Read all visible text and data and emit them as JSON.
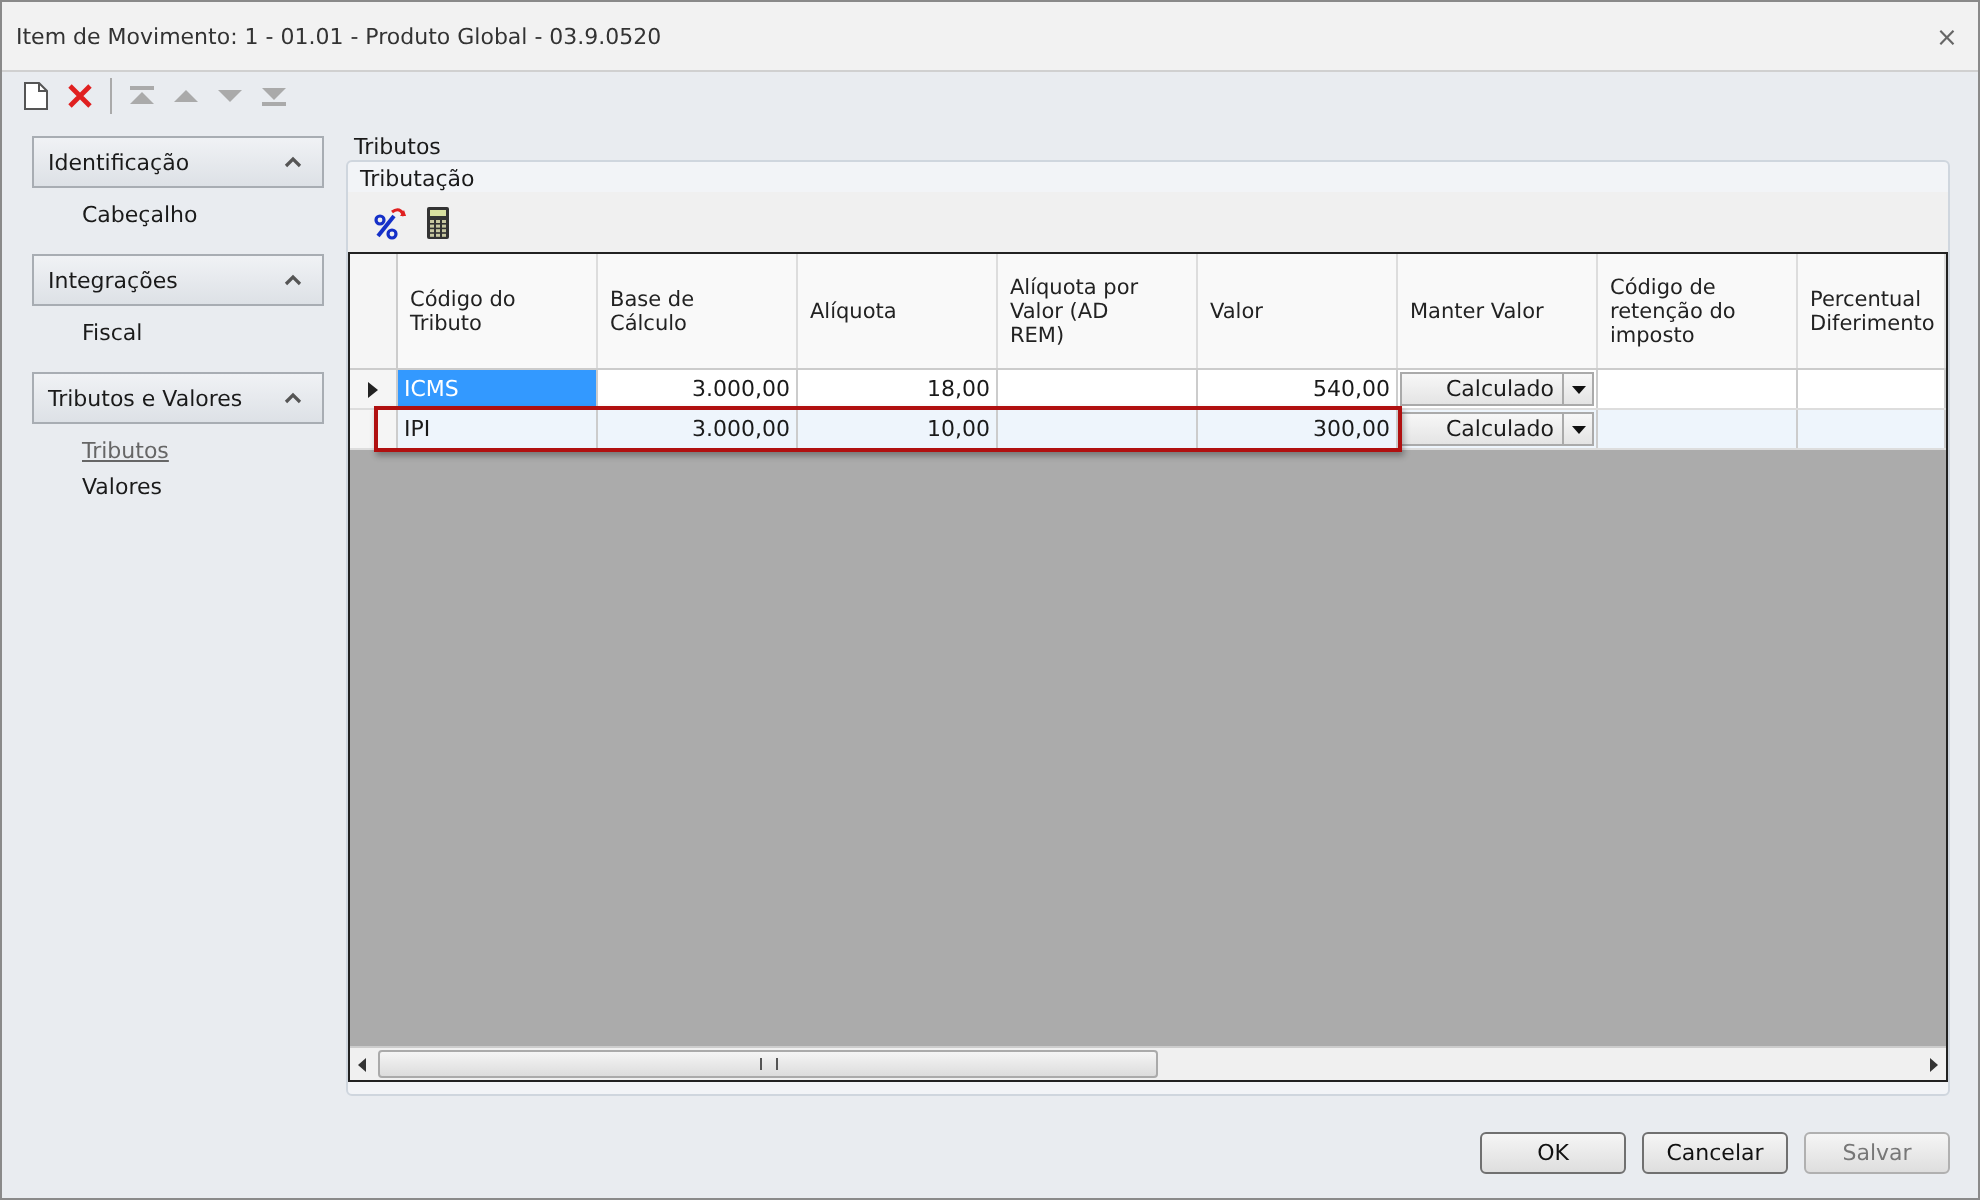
{
  "window": {
    "title": "Item de Movimento: 1 - 01.01 - Produto Global - 03.9.0520",
    "close": "⨯"
  },
  "sidebar": {
    "groups": [
      {
        "title": "Identificação",
        "expanded": true,
        "items": [
          {
            "label": "Cabeçalho",
            "selected": false
          }
        ]
      },
      {
        "title": "Integrações",
        "expanded": true,
        "items": [
          {
            "label": "Fiscal",
            "selected": false
          }
        ]
      },
      {
        "title": "Tributos e Valores",
        "expanded": true,
        "items": [
          {
            "label": "Tributos",
            "selected": true
          },
          {
            "label": "Valores",
            "selected": false
          }
        ]
      }
    ]
  },
  "panel": {
    "title": "Tributos",
    "group_title": "Tributação"
  },
  "table": {
    "columns": [
      "Código do Tributo",
      "Base de Cálculo",
      "Alíquota",
      "Alíquota por Valor (AD REM)",
      "Valor",
      "Manter Valor",
      "Código de retenção do imposto",
      "Percentual Diferimento"
    ],
    "rows": [
      {
        "current": true,
        "highlighted": false,
        "cells": [
          {
            "text": "ICMS",
            "selected": true
          },
          {
            "text": "3.000,00",
            "selected": false
          },
          {
            "text": "18,00",
            "selected": false
          },
          {
            "text": "",
            "selected": false
          },
          {
            "text": "540,00",
            "selected": false
          },
          {
            "text": "Calculado",
            "selected": false
          },
          {
            "text": "",
            "selected": false
          },
          {
            "text": "",
            "selected": false
          }
        ]
      },
      {
        "current": false,
        "highlighted": true,
        "cells": [
          {
            "text": "IPI",
            "selected": false
          },
          {
            "text": "3.000,00",
            "selected": false
          },
          {
            "text": "10,00",
            "selected": false
          },
          {
            "text": "",
            "selected": false
          },
          {
            "text": "300,00",
            "selected": false
          },
          {
            "text": "Calculado",
            "selected": false
          },
          {
            "text": "",
            "selected": false
          },
          {
            "text": "",
            "selected": false
          }
        ]
      }
    ]
  },
  "buttons": [
    {
      "label": "OK",
      "disabled": false
    },
    {
      "label": "Cancelar",
      "disabled": false
    },
    {
      "label": "Salvar",
      "disabled": true
    }
  ]
}
